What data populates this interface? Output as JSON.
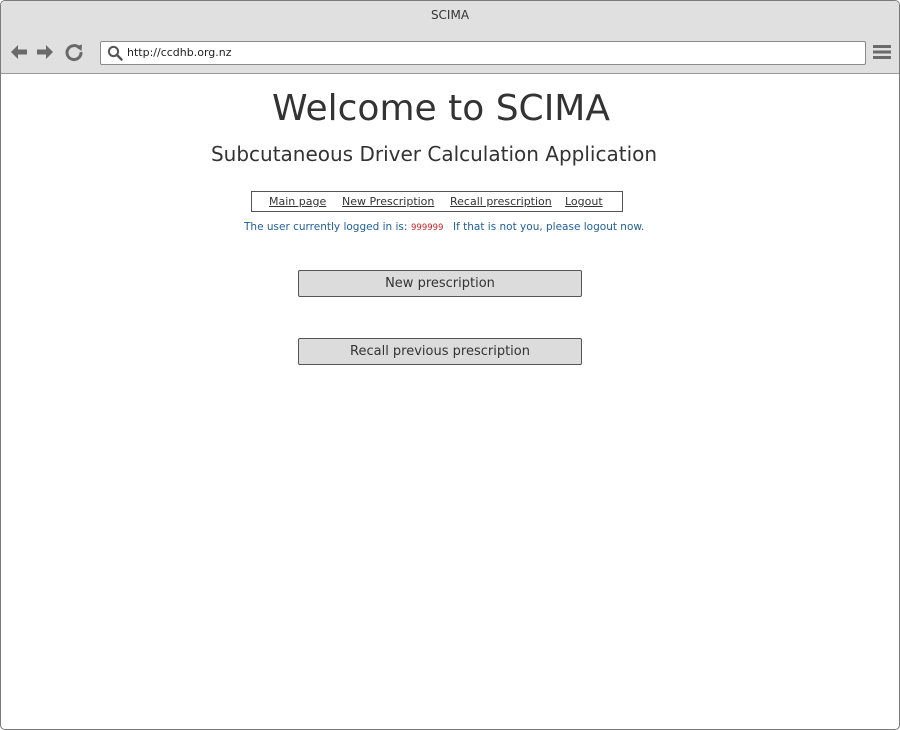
{
  "window": {
    "title": "SCIMA"
  },
  "toolbar": {
    "back_icon": "arrow-left-icon",
    "forward_icon": "arrow-right-icon",
    "reload_icon": "reload-icon",
    "search_icon": "search-icon",
    "url": "http://ccdhb.org.nz",
    "menu_icon": "hamburger-menu-icon"
  },
  "page": {
    "heading": "Welcome to SCIMA",
    "subheading": "Subcutaneous Driver Calculation Application",
    "nav": {
      "items": [
        {
          "label": "Main page"
        },
        {
          "label": "New Prescription"
        },
        {
          "label": "Recall prescription"
        },
        {
          "label": "Logout"
        }
      ]
    },
    "login": {
      "prefix": "The user currently logged in is:",
      "user_id": "999999",
      "suffix": "If that is not you, please logout now."
    },
    "buttons": {
      "new_prescription": "New prescription",
      "recall_prescription": "Recall previous prescription"
    }
  },
  "colors": {
    "chrome": "#e0e0e0",
    "button": "#dcdcdc",
    "text": "#333333",
    "login_text": "#1f5f99",
    "user_id": "#cc2222"
  }
}
